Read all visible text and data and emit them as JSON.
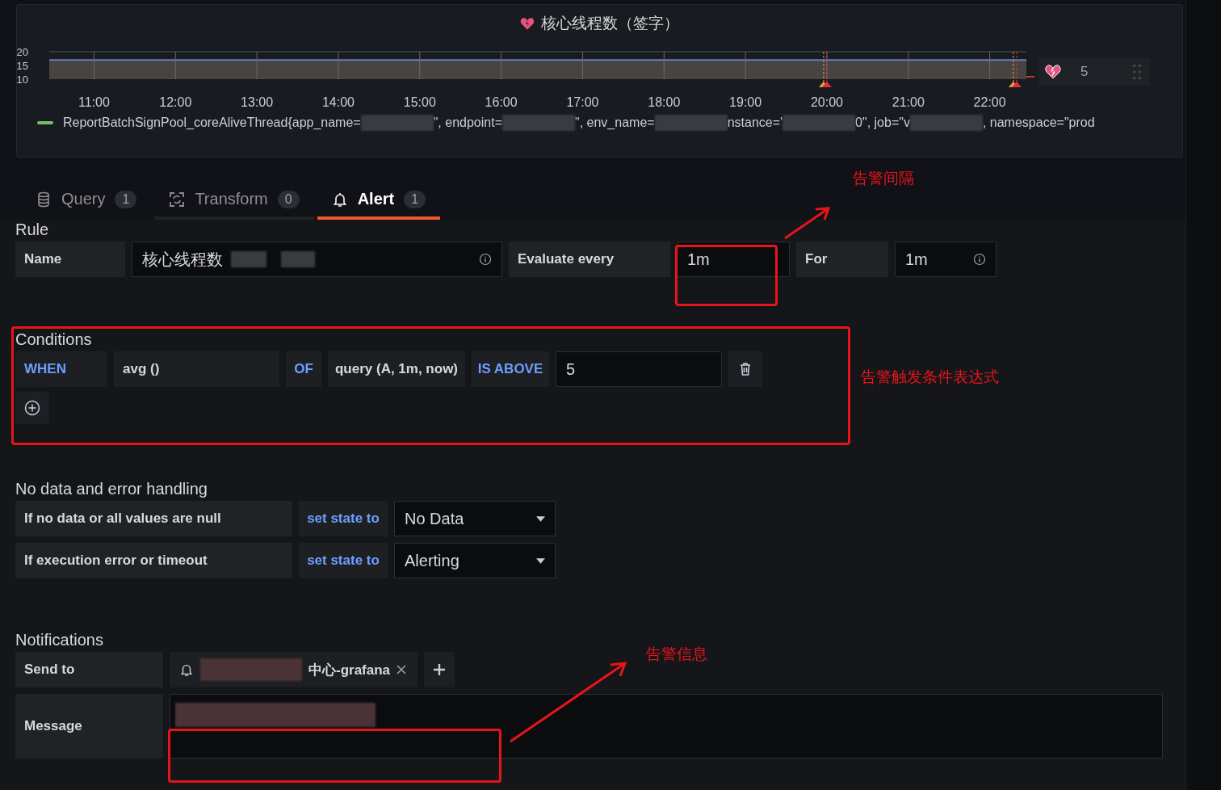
{
  "panel": {
    "title": "核心线程数（签字）",
    "chart_data": {
      "type": "area",
      "x": [
        10.45,
        22.45
      ],
      "ref_lines": [
        {
          "axis": "x",
          "value": 19.96,
          "color": "#e89c3b"
        },
        {
          "axis": "x",
          "value": 20,
          "color": "#e02f44"
        },
        {
          "axis": "x",
          "value": 22.29,
          "color": "#e89c3b"
        },
        {
          "axis": "x",
          "value": 22.33,
          "color": "#e02f44"
        }
      ],
      "xticks": [
        {
          "value": 11,
          "label": "11:00"
        },
        {
          "value": 12,
          "label": "12:00"
        },
        {
          "value": 13,
          "label": "13:00"
        },
        {
          "value": 14,
          "label": "14:00"
        },
        {
          "value": 15,
          "label": "15:00"
        },
        {
          "value": 16,
          "label": "16:00"
        },
        {
          "value": 17,
          "label": "17:00"
        },
        {
          "value": 18,
          "label": "18:00"
        },
        {
          "value": 19,
          "label": "19:00"
        },
        {
          "value": 20,
          "label": "20:00"
        },
        {
          "value": 21,
          "label": "21:00"
        },
        {
          "value": 22,
          "label": "22:00"
        }
      ],
      "yticks": [
        10,
        15,
        20
      ],
      "ylim": [
        10,
        20
      ],
      "xlim": [
        10.45,
        22.45
      ],
      "grid": true,
      "series": [
        {
          "color": "#5f7fd0",
          "values": [
            17,
            17
          ]
        }
      ]
    },
    "legend": {
      "color": "#73bf69",
      "parts": [
        {
          "kind": "text",
          "text": "ReportBatchSignPool_coreAliveThread{app_name="
        },
        {
          "kind": "redacted"
        },
        {
          "kind": "text",
          "text": "\", endpoint="
        },
        {
          "kind": "redacted"
        },
        {
          "kind": "text",
          "text": "\", env_name="
        },
        {
          "kind": "redacted"
        },
        {
          "kind": "text",
          "text": "nstance='"
        },
        {
          "kind": "redacted"
        },
        {
          "kind": "text",
          "text": "0\", job=\"v"
        },
        {
          "kind": "redacted"
        },
        {
          "kind": "text",
          "text": ", namespace=\"prod"
        }
      ]
    },
    "alert_value": "5"
  },
  "tabs": [
    {
      "kind": "database",
      "label": "Query",
      "count": "1",
      "selected": false
    },
    {
      "kind": "transform",
      "label": "Transform",
      "count": "0",
      "selected": false
    },
    {
      "kind": "bell",
      "label": "Alert",
      "count": "1",
      "selected": true
    }
  ],
  "rule": {
    "heading": "Rule",
    "name_label": "Name",
    "name_value": "核心线程数",
    "evaluate_label": "Evaluate every",
    "evaluate_value": "1m",
    "for_label": "For",
    "for_value": "1m"
  },
  "conditions": {
    "heading": "Conditions",
    "rows": [
      {
        "when": "WHEN",
        "reducer": "avg ()",
        "of": "OF",
        "query": "query (A, 1m, now)",
        "evaluator": "IS ABOVE",
        "threshold": "5"
      }
    ]
  },
  "no_data": {
    "heading": "No data and error handling",
    "rows": [
      {
        "label": "If no data or all values are null",
        "action": "set state to",
        "value": "No Data"
      },
      {
        "label": "If execution error or timeout",
        "action": "set state to",
        "value": "Alerting"
      }
    ]
  },
  "notifications": {
    "heading": "Notifications",
    "send_to_label": "Send to",
    "channels": [
      {
        "name": "中心-grafana"
      }
    ],
    "message_label": "Message"
  },
  "annotations": [
    {
      "text": "告警间隔"
    },
    {
      "text": "告警触发条件表达式"
    },
    {
      "text": "告警信息"
    }
  ]
}
